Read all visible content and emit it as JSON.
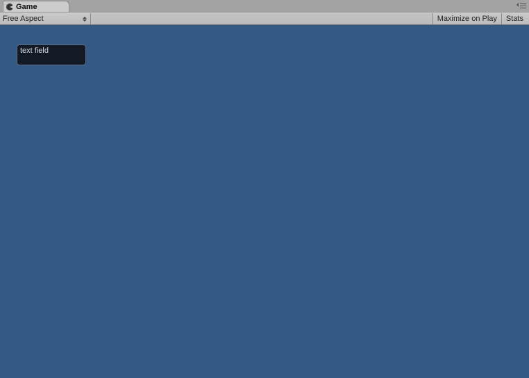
{
  "tab": {
    "label": "Game"
  },
  "toolbar": {
    "aspect_label": "Free Aspect",
    "maximize_label": "Maximize on Play",
    "stats_label": "Stats"
  },
  "viewport": {
    "background": "#345985",
    "text_field_value": "text field"
  }
}
